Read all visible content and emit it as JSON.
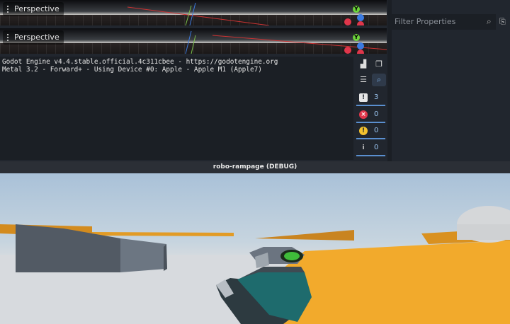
{
  "viewports": [
    {
      "label": "Perspective"
    },
    {
      "label": "Perspective"
    }
  ],
  "gizmo": {
    "y_label": "Y",
    "colors": {
      "x": "#e0364b",
      "y": "#6dd43b",
      "z": "#3b7ae0"
    }
  },
  "output": {
    "lines": [
      "Godot Engine v4.4.stable.official.4c311cbee - https://godotengine.org",
      "Metal 3.2 - Forward+ - Using Device #0: Apple - Apple M1 (Apple7)"
    ]
  },
  "filters": [
    {
      "name": "messages",
      "count": "3",
      "color": "#e6e6e6"
    },
    {
      "name": "errors",
      "count": "0",
      "color": "#e0364b"
    },
    {
      "name": "warnings",
      "count": "0",
      "color": "#f2c12e"
    },
    {
      "name": "editor",
      "count": "0",
      "color": "#cccccc"
    }
  ],
  "inspector": {
    "filter_placeholder": "Filter Properties"
  },
  "game_window": {
    "title": "robo-rampage (DEBUG)"
  },
  "colors": {
    "accent": "#5a8fcf",
    "editor_bg": "#21262e"
  }
}
